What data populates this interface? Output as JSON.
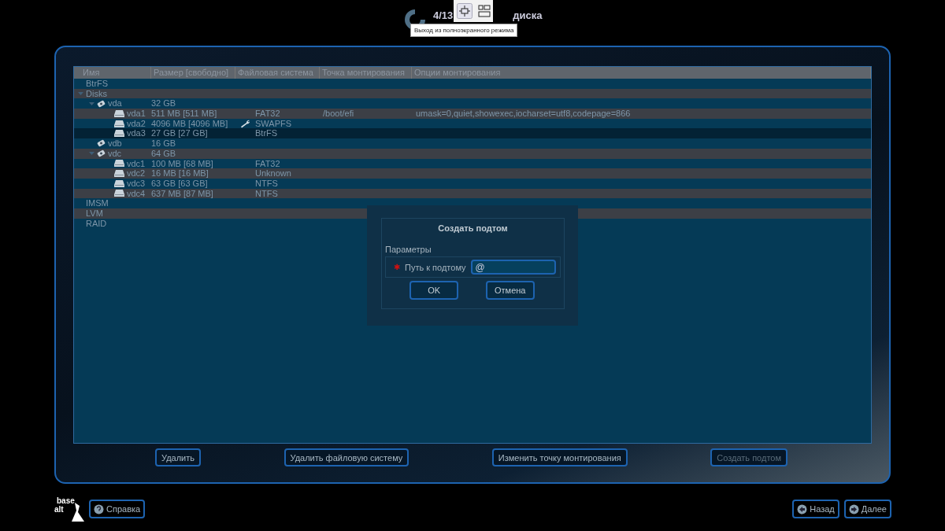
{
  "header": {
    "title_start": "4/13",
    "title_end": "диска"
  },
  "fullscreen_toolbar": {
    "tooltip": "Выход из полноэкранного режима"
  },
  "table": {
    "columns": [
      "Имя",
      "Размер [свободно]",
      "Файловая система",
      "Точка монтирования",
      "Опции монтирования"
    ],
    "tree": [
      {
        "name": "BtrFS",
        "selected": false
      },
      {
        "name": "Disks",
        "selected": false,
        "expanded": true,
        "children": [
          {
            "kind": "disk",
            "name": "vda",
            "size": "32 GB",
            "selected": false,
            "expanded": true,
            "children": [
              {
                "kind": "partition",
                "name": "vda1",
                "size": "511 MB [511 MB]",
                "fs": "FAT32",
                "mount": "/boot/efi",
                "options": "umask=0,quiet,showexec,iocharset=utf8,codepage=866",
                "wrench": false,
                "selected": false
              },
              {
                "kind": "partition",
                "name": "vda2",
                "size": "4096 MB [4096 MB]",
                "fs": "SWAPFS",
                "wrench": true,
                "selected": false
              },
              {
                "kind": "partition",
                "name": "vda3",
                "size": "27 GB [27 GB]",
                "fs": "BtrFS",
                "wrench": false,
                "selected": true
              }
            ]
          },
          {
            "kind": "disk",
            "name": "vdb",
            "size": "16 GB",
            "selected": false
          },
          {
            "kind": "disk",
            "name": "vdc",
            "size": "64 GB",
            "selected": false,
            "expanded": true,
            "children": [
              {
                "kind": "partition",
                "name": "vdc1",
                "size": "100 MB [68 MB]",
                "fs": "FAT32",
                "wrench": false,
                "selected": false
              },
              {
                "kind": "partition",
                "name": "vdc2",
                "size": "16 MB [16 MB]",
                "fs": "Unknown",
                "wrench": false,
                "selected": false
              },
              {
                "kind": "partition",
                "name": "vdc3",
                "size": "63 GB [63 GB]",
                "fs": "NTFS",
                "wrench": false,
                "selected": false
              },
              {
                "kind": "partition",
                "name": "vdc4",
                "size": "637 MB [87 MB]",
                "fs": "NTFS",
                "wrench": false,
                "selected": false
              }
            ]
          }
        ]
      },
      {
        "name": "IMSM",
        "selected": false
      },
      {
        "name": "LVM",
        "selected": false
      },
      {
        "name": "RAID",
        "selected": false
      }
    ]
  },
  "actions": [
    {
      "label": "Удалить",
      "disabled": false
    },
    {
      "label": "Удалить файловую систему",
      "disabled": false
    },
    {
      "label": "Изменить точку монтирования",
      "disabled": false
    },
    {
      "label": "Создать подтом",
      "disabled": true
    }
  ],
  "dialog": {
    "title": "Создать подтом",
    "section": "Параметры",
    "field": {
      "required_mark": "✱",
      "label": "Путь к подтому",
      "value": "@"
    },
    "buttons": [
      "OK",
      "Отмена"
    ]
  },
  "footer": {
    "logo_top": "base",
    "logo_bottom": "alt",
    "help": "Справка",
    "back": "Назад",
    "next": "Далее"
  }
}
